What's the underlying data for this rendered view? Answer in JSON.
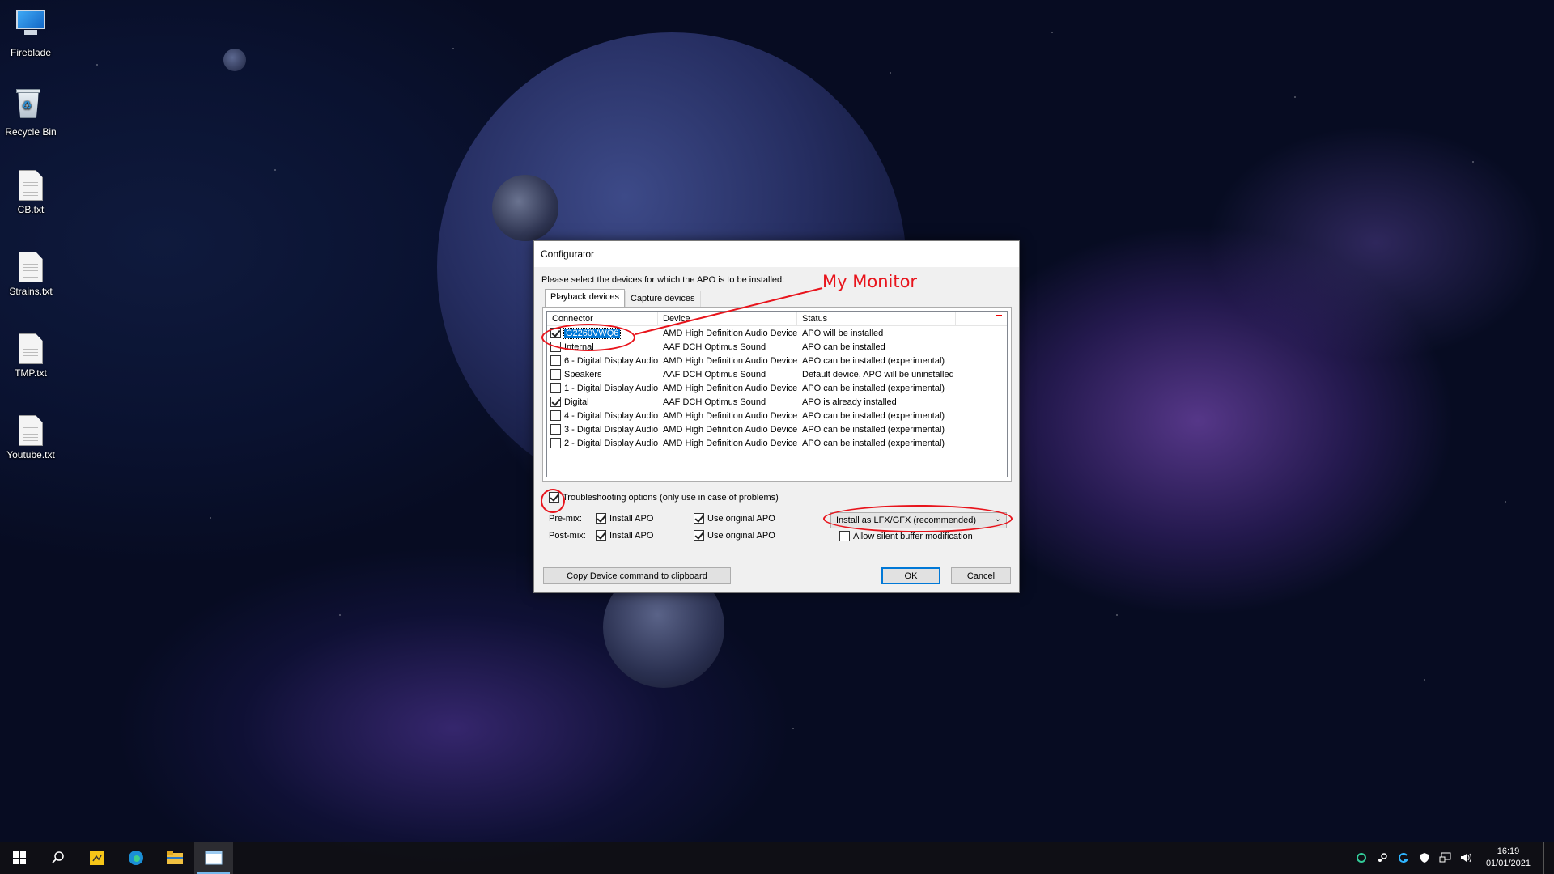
{
  "desktop": {
    "icons": [
      {
        "label": "Fireblade",
        "icon": "computer-icon"
      },
      {
        "label": "Recycle Bin",
        "icon": "recycle-bin-icon"
      },
      {
        "label": "CB.txt",
        "icon": "text-file-icon"
      },
      {
        "label": "Strains.txt",
        "icon": "text-file-icon"
      },
      {
        "label": "TMP.txt",
        "icon": "text-file-icon"
      },
      {
        "label": "Youtube.txt",
        "icon": "text-file-icon"
      }
    ]
  },
  "dialog": {
    "title": "Configurator",
    "prompt": "Please select the devices for which the APO is to be installed:",
    "tabs": [
      "Playback devices",
      "Capture devices"
    ],
    "columns": [
      "Connector",
      "Device",
      "Status"
    ],
    "rows": [
      {
        "connector": "G2260VWQ6",
        "device": "AMD High Definition Audio Device",
        "status": "APO will be installed",
        "checked": true
      },
      {
        "connector": "Internal",
        "device": "AAF DCH Optimus Sound",
        "status": "APO can be installed",
        "checked": false
      },
      {
        "connector": "6 - Digital Display Audio",
        "device": "AMD High Definition Audio Device",
        "status": "APO can be installed (experimental)",
        "checked": false
      },
      {
        "connector": "Speakers",
        "device": "AAF DCH Optimus Sound",
        "status": "Default device, APO will be uninstalled",
        "checked": false
      },
      {
        "connector": "1 - Digital Display Audio",
        "device": "AMD High Definition Audio Device",
        "status": "APO can be installed (experimental)",
        "checked": false
      },
      {
        "connector": "Digital",
        "device": "AAF DCH Optimus Sound",
        "status": "APO is already installed",
        "checked": true
      },
      {
        "connector": "4 - Digital Display Audio",
        "device": "AMD High Definition Audio Device",
        "status": "APO can be installed (experimental)",
        "checked": false
      },
      {
        "connector": "3 - Digital Display Audio",
        "device": "AMD High Definition Audio Device",
        "status": "APO can be installed (experimental)",
        "checked": false
      },
      {
        "connector": "2 - Digital Display Audio",
        "device": "AMD High Definition Audio Device",
        "status": "APO can be installed (experimental)",
        "checked": false
      }
    ],
    "troubleshooting_label": "Troubleshooting options (only use in case of problems)",
    "premix_label": "Pre-mix:",
    "postmix_label": "Post-mix:",
    "install_apo_label": "Install APO",
    "use_original_label": "Use original APO",
    "install_mode": "Install as LFX/GFX (recommended)",
    "silent_buffer_label": "Allow silent buffer modification",
    "copy_button": "Copy Device command to clipboard",
    "ok_button": "OK",
    "cancel_button": "Cancel"
  },
  "annotation": {
    "text": "My Monitor",
    "color": "#e8141c"
  },
  "taskbar": {
    "time": "16:19",
    "date": "01/01/2021"
  }
}
